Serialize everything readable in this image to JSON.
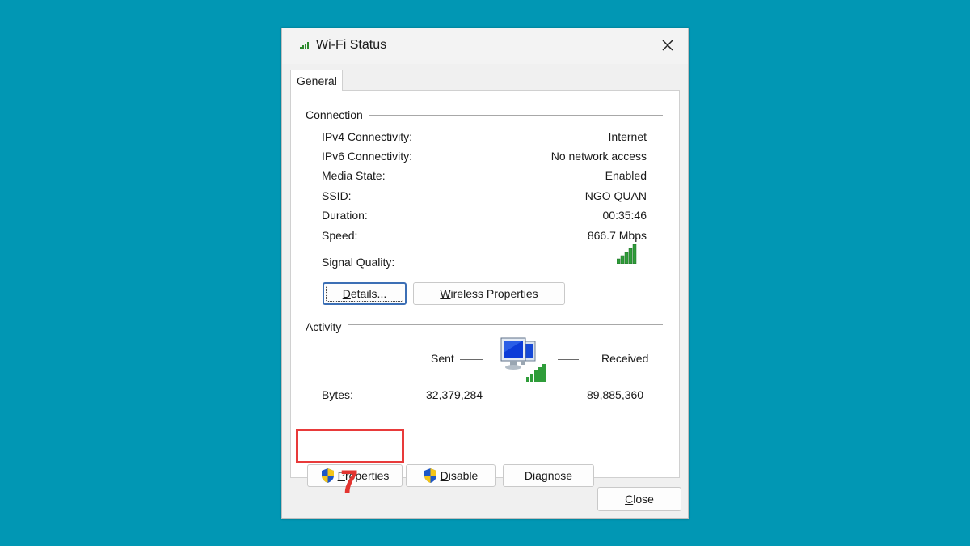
{
  "window": {
    "title": "Wi-Fi Status",
    "tab": "General"
  },
  "connection": {
    "group_title": "Connection",
    "rows": [
      {
        "label": "IPv4 Connectivity:",
        "value": "Internet"
      },
      {
        "label": "IPv6 Connectivity:",
        "value": "No network access"
      },
      {
        "label": "Media State:",
        "value": "Enabled"
      },
      {
        "label": "SSID:",
        "value": "NGO QUAN"
      },
      {
        "label": "Duration:",
        "value": "00:35:46"
      },
      {
        "label": "Speed:",
        "value": "866.7 Mbps"
      }
    ],
    "signal_label": "Signal Quality:",
    "details_prefix": "D",
    "details_rest": "etails...",
    "wireless_prefix": "W",
    "wireless_rest": "ireless Properties"
  },
  "activity": {
    "group_title": "Activity",
    "sent_label": "Sent",
    "received_label": "Received",
    "bytes_label": "Bytes:",
    "bytes_sent": "32,379,284",
    "bytes_received": "89,885,360"
  },
  "buttons": {
    "properties_prefix": "P",
    "properties_rest": "roperties",
    "disable_prefix": "D",
    "disable_rest": "isable",
    "diagnose": "Diagnose",
    "close_prefix": "C",
    "close_rest": "lose"
  },
  "annotation": {
    "step_number": "7",
    "color": "#e83a3a"
  },
  "icons": [
    "wifi-signal-icon",
    "close-icon",
    "shield-icon",
    "network-computers-icon"
  ]
}
